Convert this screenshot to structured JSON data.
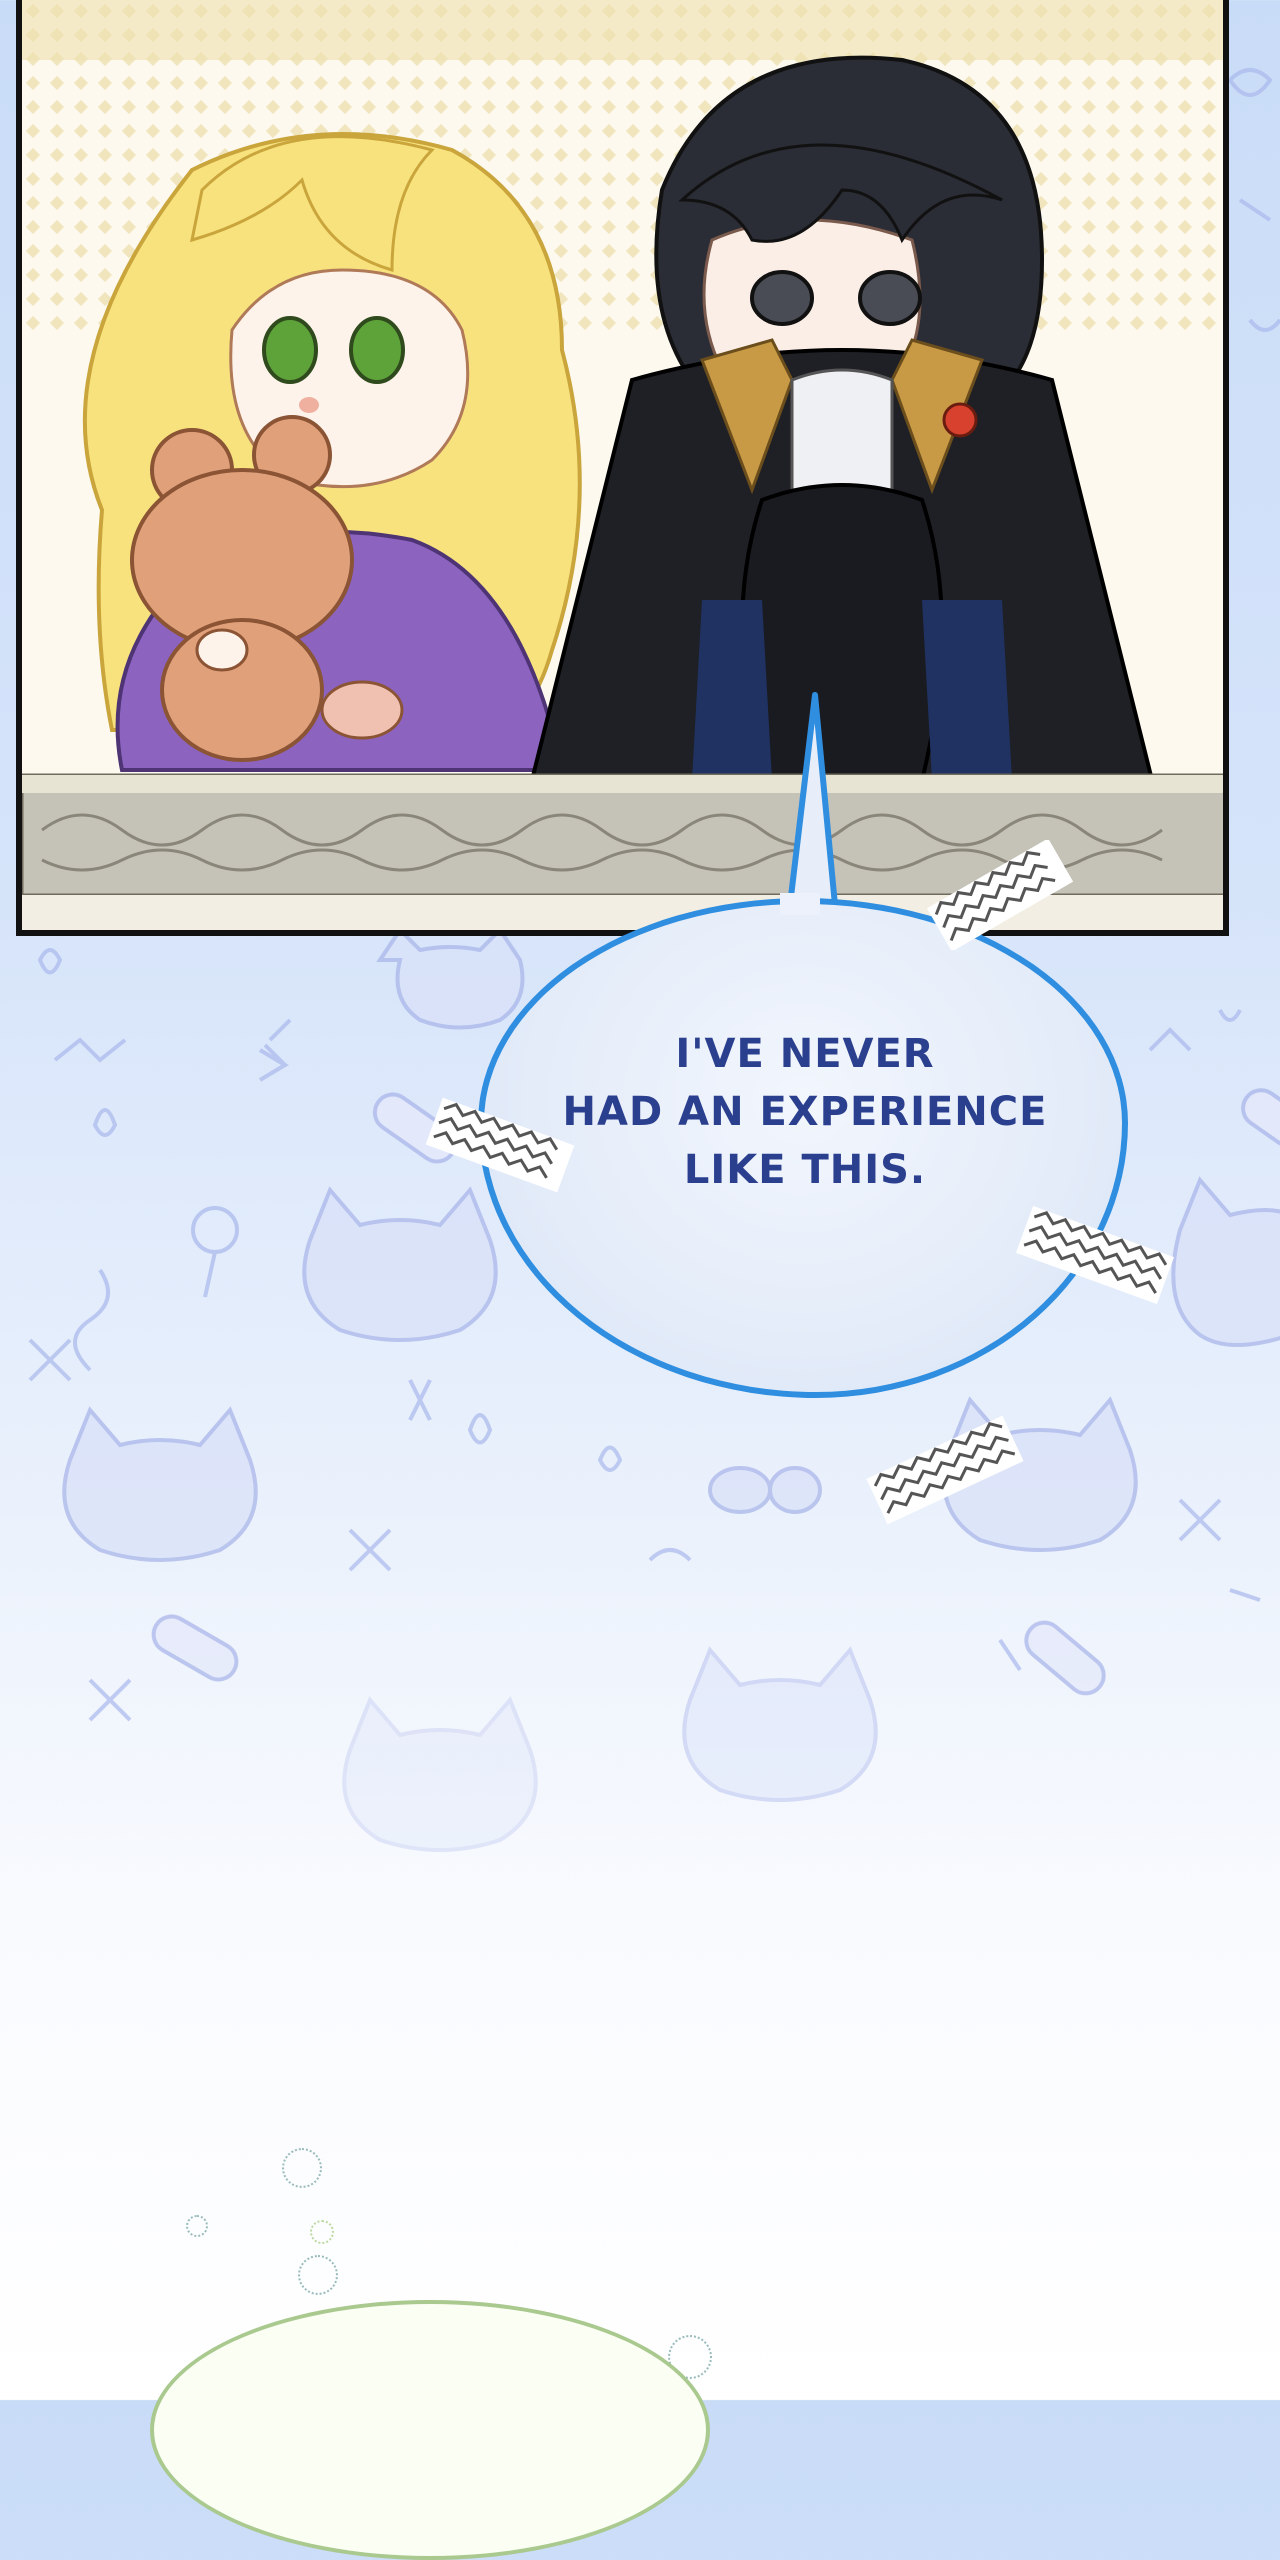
{
  "panel": {
    "characters": [
      "blonde-girl-with-teddy-bear",
      "dark-haired-boy-in-black-coat"
    ]
  },
  "speech_bubble": {
    "text": "I'VE NEVER\nHAD AN EXPERIENCE\nLIKE THIS."
  },
  "colors": {
    "background_top": "#c9dcf7",
    "background_bottom": "#ffffff",
    "bubble_border": "#2f8ee0",
    "bubble_text": "#2b3f8f",
    "panel_border": "#111111"
  }
}
